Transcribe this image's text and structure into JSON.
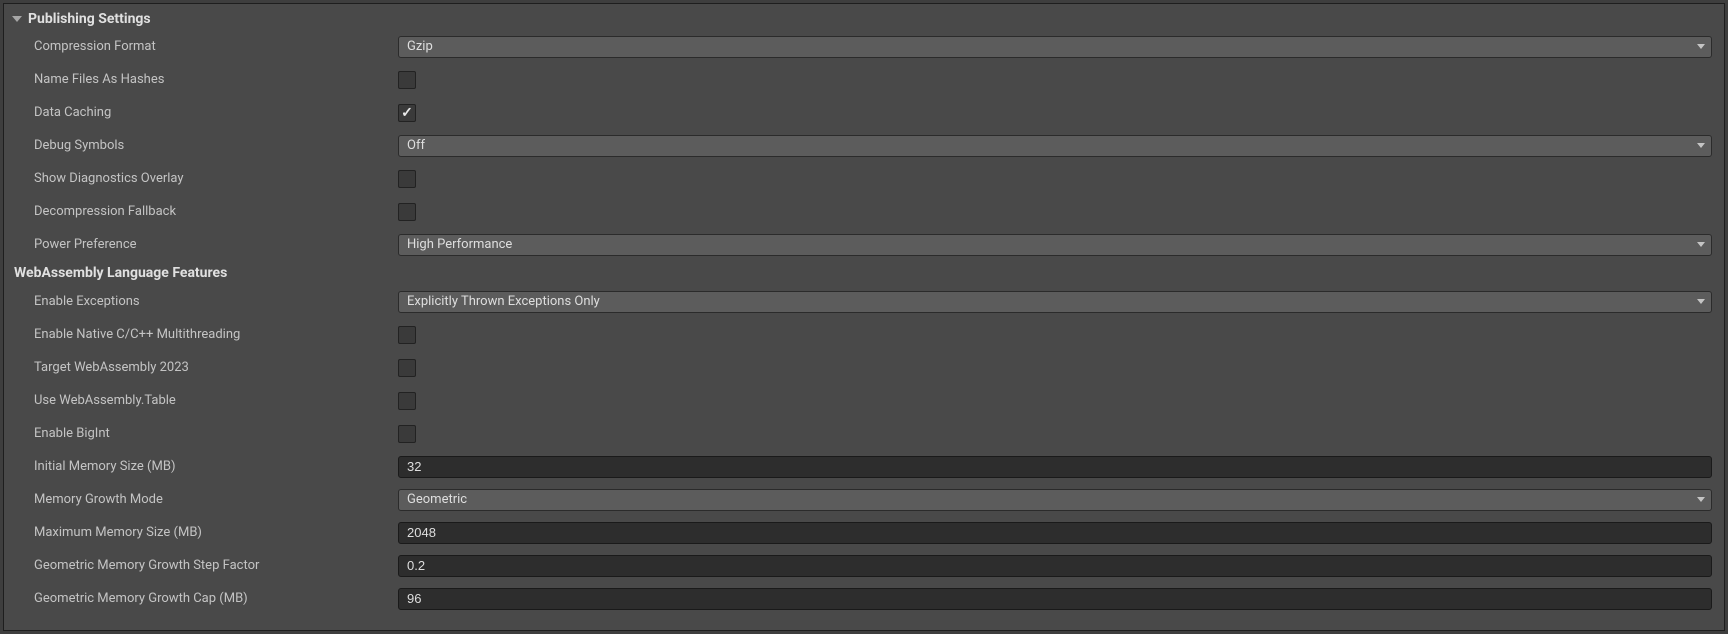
{
  "sections": {
    "publishing": {
      "title": "Publishing Settings",
      "fields": {
        "compressionFormat": {
          "label": "Compression Format",
          "value": "Gzip"
        },
        "nameFilesAsHashes": {
          "label": "Name Files As Hashes",
          "checked": false
        },
        "dataCaching": {
          "label": "Data Caching",
          "checked": true
        },
        "debugSymbols": {
          "label": "Debug Symbols",
          "value": "Off"
        },
        "showDiagnosticsOverlay": {
          "label": "Show Diagnostics Overlay",
          "checked": false
        },
        "decompressionFallback": {
          "label": "Decompression Fallback",
          "checked": false
        },
        "powerPreference": {
          "label": "Power Preference",
          "value": "High Performance"
        }
      }
    },
    "wasm": {
      "title": "WebAssembly Language Features",
      "fields": {
        "enableExceptions": {
          "label": "Enable Exceptions",
          "value": "Explicitly Thrown Exceptions Only"
        },
        "enableNativeMultithreading": {
          "label": "Enable Native C/C++ Multithreading",
          "checked": false
        },
        "targetWasm2023": {
          "label": "Target WebAssembly 2023",
          "checked": false
        },
        "useWasmTable": {
          "label": "Use WebAssembly.Table",
          "checked": false
        },
        "enableBigInt": {
          "label": "Enable BigInt",
          "checked": false
        },
        "initialMemorySize": {
          "label": "Initial Memory Size (MB)",
          "value": "32"
        },
        "memoryGrowthMode": {
          "label": "Memory Growth Mode",
          "value": "Geometric"
        },
        "maximumMemorySize": {
          "label": "Maximum Memory Size (MB)",
          "value": "2048"
        },
        "geometricGrowthStepFactor": {
          "label": "Geometric Memory Growth Step Factor",
          "value": "0.2"
        },
        "geometricGrowthCap": {
          "label": "Geometric Memory Growth Cap (MB)",
          "value": "96"
        }
      }
    }
  }
}
